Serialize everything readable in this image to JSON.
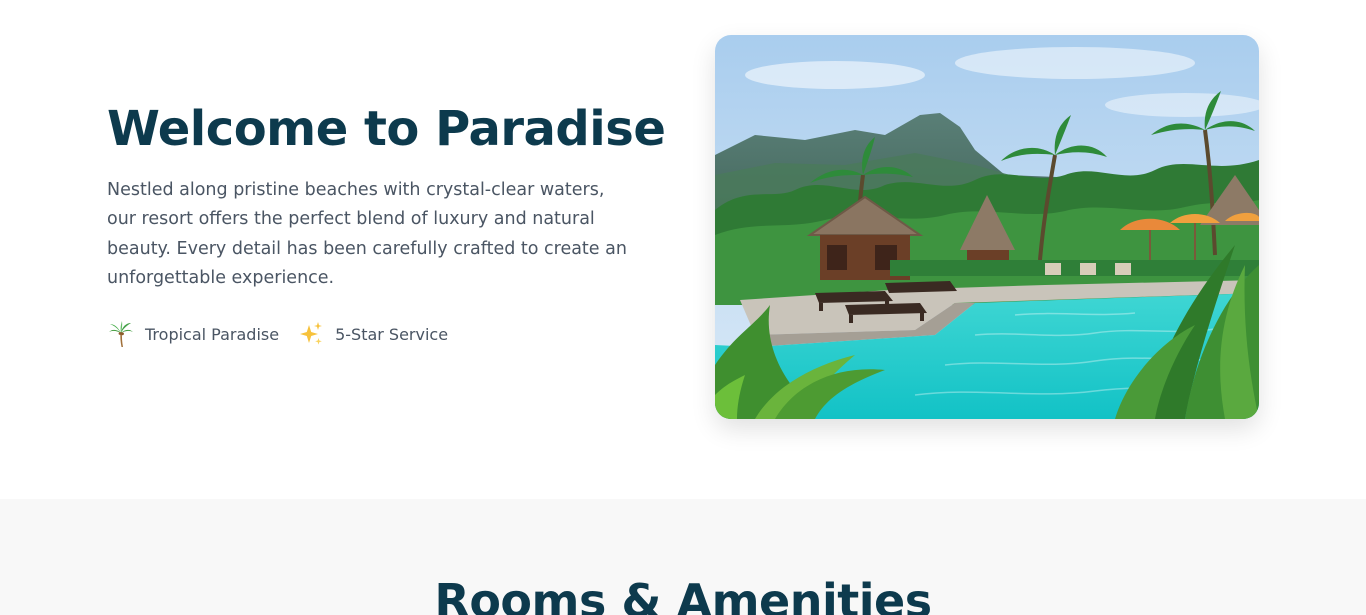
{
  "welcome": {
    "title": "Welcome to Paradise",
    "description": "Nestled along pristine beaches with crystal-clear waters, our resort offers the perfect blend of luxury and natural beauty. Every detail has been carefully crafted to create an unforgettable experience.",
    "features": [
      {
        "icon": "palm-tree-icon",
        "label": "Tropical Paradise"
      },
      {
        "icon": "sparkles-icon",
        "label": "5-Star Service"
      }
    ],
    "image": {
      "subject": "tropical-resort-pool"
    }
  },
  "rooms": {
    "title": "Rooms & Amenities"
  },
  "colors": {
    "heading": "#0d3a4d",
    "body_text": "#4a5563",
    "section_alt_bg": "#f8f8f8",
    "page_bg": "#ffffff"
  }
}
